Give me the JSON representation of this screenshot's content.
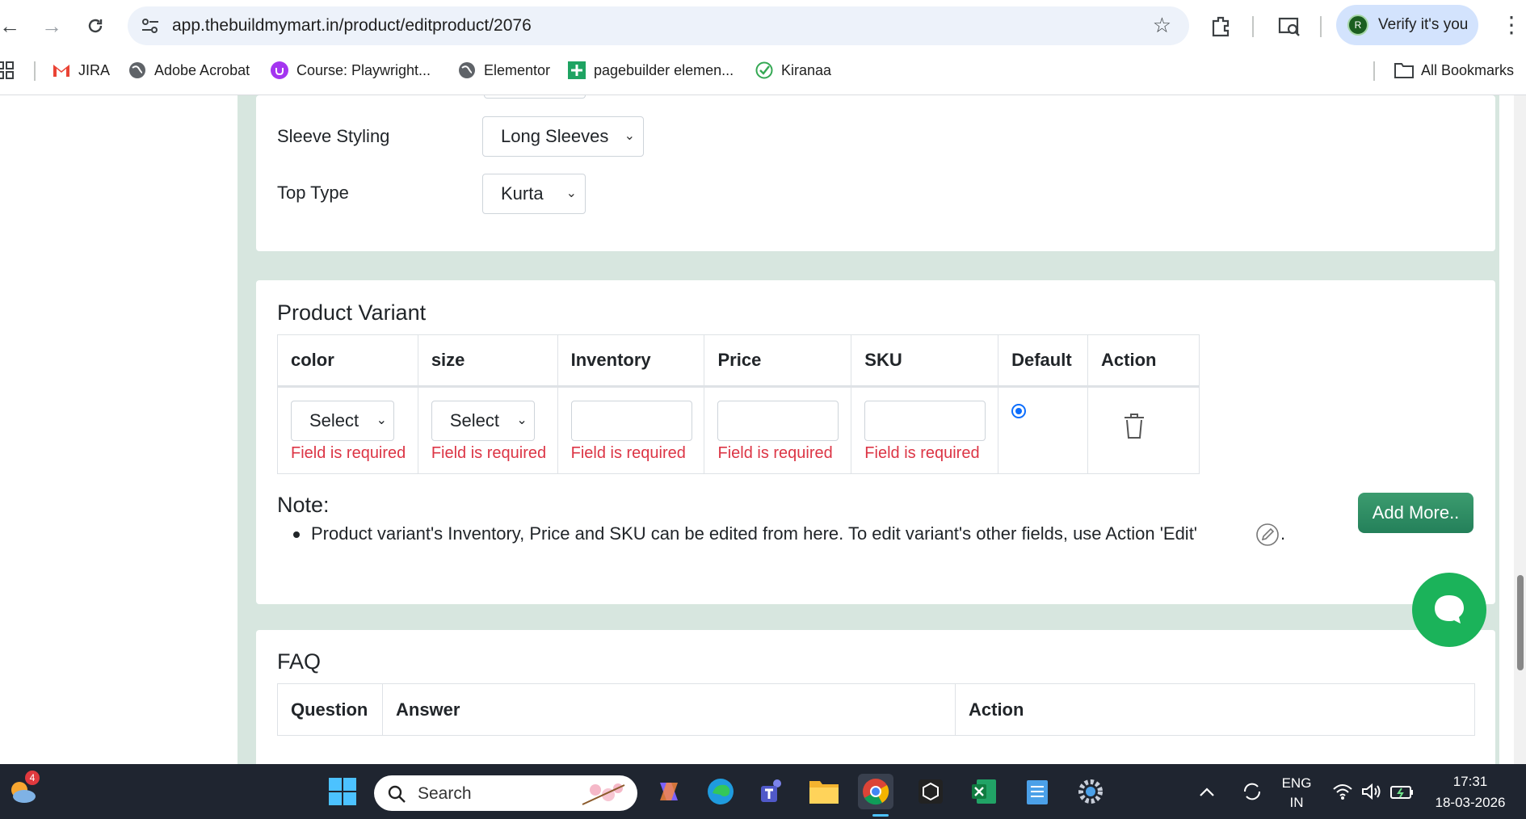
{
  "browser": {
    "url": "app.thebuildmymart.in/product/editproduct/2076",
    "profile_button": "Verify it's you",
    "profile_initial": "R",
    "bookmarks": [
      "JIRA",
      "Adobe Acrobat",
      "Course: Playwright...",
      "Elementor",
      "pagebuilder elemen...",
      "Kiranaa"
    ],
    "all_bookmarks": "All Bookmarks"
  },
  "attributes": {
    "sleeve_label": "Sleeve Styling",
    "sleeve_value": "Long Sleeves",
    "top_label": "Top Type",
    "top_value": "Kurta"
  },
  "variant": {
    "title": "Product Variant",
    "headers": [
      "color",
      "size",
      "Inventory",
      "Price",
      "SKU",
      "Default",
      "Action"
    ],
    "color_select": "Select",
    "size_select": "Select",
    "error": "Field is required",
    "default_selected": true
  },
  "note": {
    "title": "Note:",
    "text": "Product variant's Inventory, Price and SKU can be edited from here. To edit variant's other fields, use Action 'Edit'",
    "end": "."
  },
  "add_more": "Add More..",
  "faq": {
    "title": "FAQ",
    "headers": [
      "Question",
      "Answer",
      "Action"
    ]
  },
  "taskbar": {
    "search": "Search",
    "notification_count": "4",
    "lang": "ENG",
    "region": "IN",
    "time": "17:31",
    "date": "18-03-2026"
  },
  "colors": {
    "accent_green": "#24805a",
    "error_red": "#dc3545",
    "page_bg": "#d7e6df"
  }
}
